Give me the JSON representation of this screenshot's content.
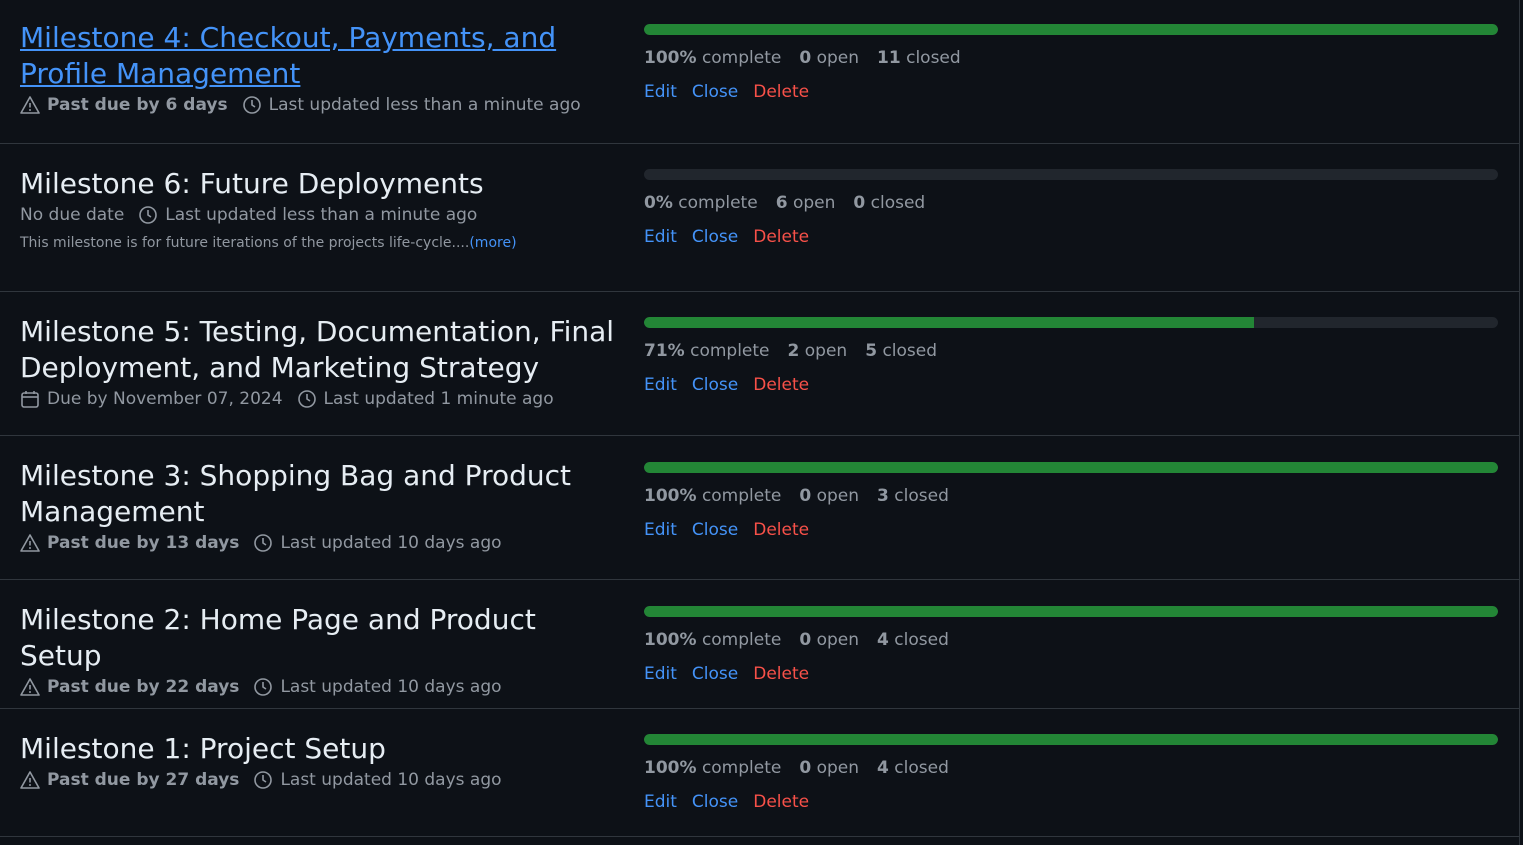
{
  "milestones": [
    {
      "title": "Milestone 4: Checkout, Payments, and Profile Management",
      "due_prefix": "Past due by",
      "due_value": "6 days",
      "updated": "Last updated less than a minute ago",
      "percent_text": "100%",
      "complete_label": "complete",
      "open_count": "0",
      "open_label": "open",
      "closed_count": "11",
      "closed_label": "closed",
      "progress": 1.0
    },
    {
      "title": "Milestone 6: Future Deployments",
      "due_text": "No due date",
      "updated": "Last updated less than a minute ago",
      "description": "This milestone is for future iterations of the projects life-cycle....",
      "more_label": "(more)",
      "percent_text": "0%",
      "complete_label": "complete",
      "open_count": "6",
      "open_label": "open",
      "closed_count": "0",
      "closed_label": "closed",
      "progress": 0.0
    },
    {
      "title": "Milestone 5: Testing, Documentation, Final Deployment, and Marketing Strategy",
      "due_text": "Due by November 07, 2024",
      "updated": "Last updated 1 minute ago",
      "percent_text": "71%",
      "complete_label": "complete",
      "open_count": "2",
      "open_label": "open",
      "closed_count": "5",
      "closed_label": "closed",
      "progress": 0.714
    },
    {
      "title": "Milestone 3: Shopping Bag and Product Management",
      "due_prefix": "Past due by",
      "due_value": "13 days",
      "updated": "Last updated 10 days ago",
      "percent_text": "100%",
      "complete_label": "complete",
      "open_count": "0",
      "open_label": "open",
      "closed_count": "3",
      "closed_label": "closed",
      "progress": 1.0
    },
    {
      "title": "Milestone 2: Home Page and Product Setup",
      "due_prefix": "Past due by",
      "due_value": "22 days",
      "updated": "Last updated 10 days ago",
      "percent_text": "100%",
      "complete_label": "complete",
      "open_count": "0",
      "open_label": "open",
      "closed_count": "4",
      "closed_label": "closed",
      "progress": 1.0
    },
    {
      "title": "Milestone 1: Project Setup",
      "due_prefix": "Past due by",
      "due_value": "27 days",
      "updated": "Last updated 10 days ago",
      "percent_text": "100%",
      "complete_label": "complete",
      "open_count": "0",
      "open_label": "open",
      "closed_count": "4",
      "closed_label": "closed",
      "progress": 1.0
    }
  ],
  "actions": {
    "edit": "Edit",
    "close": "Close",
    "delete": "Delete"
  },
  "colors": {
    "progress_fill": "#238636",
    "link": "#4493f8",
    "danger": "#f85149"
  },
  "icons": {
    "past_due": "alert-icon",
    "due": "calendar-icon",
    "updated": "clock-icon"
  }
}
